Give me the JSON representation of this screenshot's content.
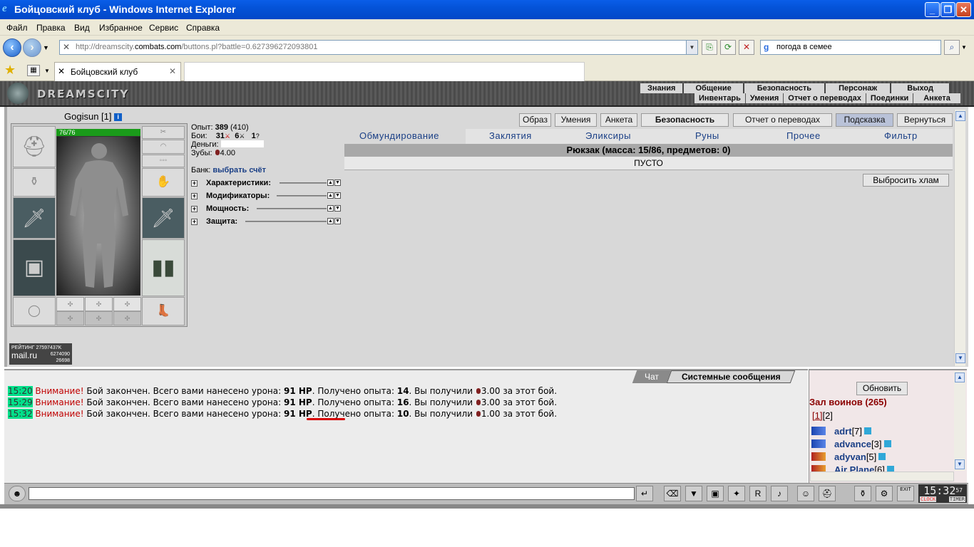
{
  "window": {
    "title": "Бойцовский клуб - Windows Internet Explorer"
  },
  "menu": [
    "Файл",
    "Правка",
    "Вид",
    "Избранное",
    "Сервис",
    "Справка"
  ],
  "address": {
    "url_prefix": "http://dreamscity.",
    "url_domain": "combats.com",
    "url_suffix": "/buttons.pl?battle=0.627396272093801",
    "search_value": "погода в семее"
  },
  "tabs": {
    "active_label": "Бойцовский клуб"
  },
  "game": {
    "logo": "DREAMSCITY",
    "topnav_row1": [
      "Знания",
      "Общение",
      "Безопасность",
      "Персонаж",
      "Выход"
    ],
    "topnav_row2": [
      "Инвентарь",
      "Умения",
      "Отчет о переводах",
      "Поединки",
      "Анкета"
    ],
    "character": {
      "name": "Gogisun",
      "level": "[1]",
      "hp": "76/76"
    },
    "stats": {
      "exp_label": "Опыт:",
      "exp_value": "389",
      "exp_next": "(410)",
      "fights_label": "Бои:",
      "wins": "31",
      "losses": "6",
      "draws": "1",
      "money_label": "Деньги:",
      "teeth_label": "Зубы:",
      "teeth_value": "4.00",
      "bank_label": "Банк:",
      "bank_link": "выбрать счёт"
    },
    "accordion": [
      "Характеристики:",
      "Модификаторы:",
      "Мощность:",
      "Защита:"
    ],
    "buttons": [
      "Образ",
      "Умения",
      "Анкета",
      "Безопасность",
      "Отчет о переводах",
      "Подсказка",
      "Вернуться"
    ],
    "inventory_tabs": [
      "Обмундирование",
      "Заклятия",
      "Эликсиры",
      "Руны",
      "Прочее",
      "Фильтр"
    ],
    "rucksack": "Рюкзак (масса: 15/86, предметов: 0)",
    "empty_label": "ПУСТО",
    "junk_button": "Выбросить хлам",
    "rating": {
      "label": "РЕЙТИНГ 27597437K",
      "brand": "mail.ru",
      "n1": "6274090",
      "n2": "26698"
    }
  },
  "chat": {
    "tabs": [
      "Чат",
      "Системные сообщения"
    ],
    "messages": [
      {
        "time": "15:20",
        "warn": "Внимание!",
        "text1": "Бой закончен. Всего вами нанесено урона:",
        "damage": "91 HP",
        "text2": ". Получено опыта:",
        "exp": "14",
        "text3": ". Вы получили",
        "money": "3.00",
        "text4": "за этот бой."
      },
      {
        "time": "15:29",
        "warn": "Внимание!",
        "text1": "Бой закончен. Всего вами нанесено урона:",
        "damage": "91 HP",
        "text2": ". Получено опыта:",
        "exp": "16",
        "text3": ". Вы получили",
        "money": "3.00",
        "text4": "за этот бой."
      },
      {
        "time": "15:32",
        "warn": "Внимание!",
        "text1": "Бой закончен. Всего вами нанесено урона:",
        "damage": "91 HP",
        "text2": ". Получено опыта:",
        "exp": "10",
        "text3": ". Вы получили",
        "money": "1.00",
        "text4": "за этот бой."
      }
    ]
  },
  "room": {
    "refresh_button": "Обновить",
    "title": "Зал воинов (265)",
    "page1": "[1]",
    "page2": "[2]",
    "warriors": [
      {
        "name": "adrt",
        "level": "[7]"
      },
      {
        "name": "advance",
        "level": "[3]"
      },
      {
        "name": "adyvan",
        "level": "[5]"
      },
      {
        "name": "Air Plane",
        "level": "[6]"
      }
    ]
  },
  "clock": {
    "time": "15:32",
    "seconds": "57",
    "label_clock": "CLOCK",
    "label_timer": "TIMER",
    "exit": "EXIT"
  }
}
